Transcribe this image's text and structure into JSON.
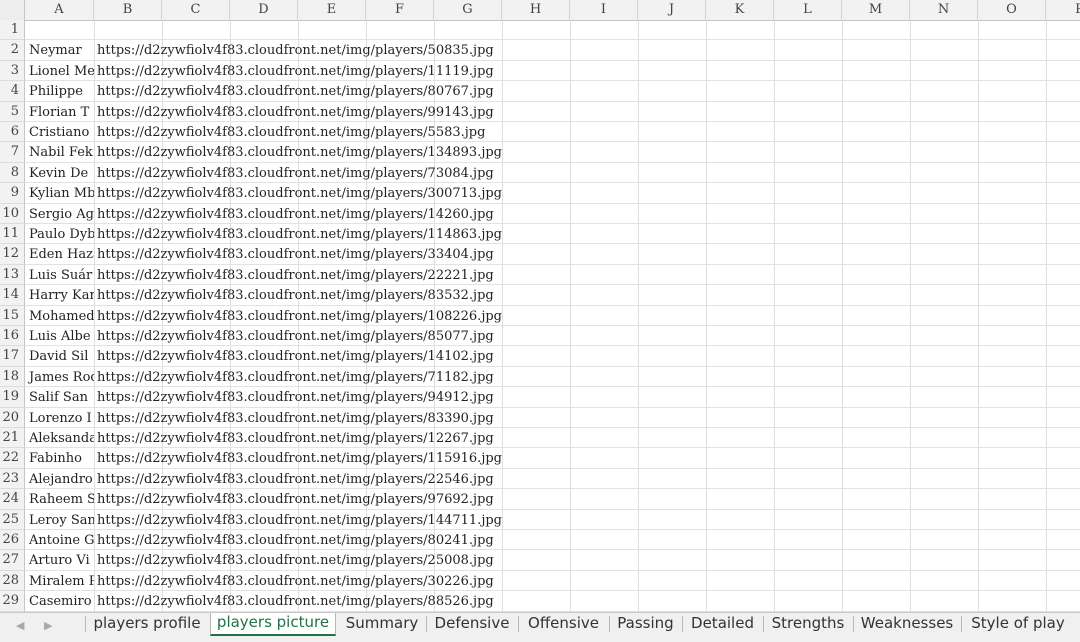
{
  "columns": [
    "A",
    "B",
    "C",
    "D",
    "E",
    "F",
    "G",
    "H",
    "I",
    "J",
    "K",
    "L",
    "M",
    "N",
    "O",
    "P"
  ],
  "rows": [
    {
      "num": "1",
      "a": "",
      "b": ""
    },
    {
      "num": "2",
      "a": "Neymar",
      "b": "https://d2zywfiolv4f83.cloudfront.net/img/players/50835.jpg"
    },
    {
      "num": "3",
      "a": "Lionel Me",
      "b": "https://d2zywfiolv4f83.cloudfront.net/img/players/11119.jpg"
    },
    {
      "num": "4",
      "a": "Philippe",
      "b": "https://d2zywfiolv4f83.cloudfront.net/img/players/80767.jpg"
    },
    {
      "num": "5",
      "a": "Florian T",
      "b": "https://d2zywfiolv4f83.cloudfront.net/img/players/99143.jpg"
    },
    {
      "num": "6",
      "a": "Cristiano",
      "b": "https://d2zywfiolv4f83.cloudfront.net/img/players/5583.jpg"
    },
    {
      "num": "7",
      "a": "Nabil Fek",
      "b": "https://d2zywfiolv4f83.cloudfront.net/img/players/134893.jpg"
    },
    {
      "num": "8",
      "a": "Kevin De",
      "b": "https://d2zywfiolv4f83.cloudfront.net/img/players/73084.jpg"
    },
    {
      "num": "9",
      "a": "Kylian Mb",
      "b": "https://d2zywfiolv4f83.cloudfront.net/img/players/300713.jpg"
    },
    {
      "num": "10",
      "a": "Sergio Ag",
      "b": "https://d2zywfiolv4f83.cloudfront.net/img/players/14260.jpg"
    },
    {
      "num": "11",
      "a": "Paulo Dyb",
      "b": "https://d2zywfiolv4f83.cloudfront.net/img/players/114863.jpg"
    },
    {
      "num": "12",
      "a": "Eden Haza",
      "b": "https://d2zywfiolv4f83.cloudfront.net/img/players/33404.jpg"
    },
    {
      "num": "13",
      "a": "Luis Suár",
      "b": "https://d2zywfiolv4f83.cloudfront.net/img/players/22221.jpg"
    },
    {
      "num": "14",
      "a": "Harry Kan",
      "b": "https://d2zywfiolv4f83.cloudfront.net/img/players/83532.jpg"
    },
    {
      "num": "15",
      "a": "Mohamed S",
      "b": "https://d2zywfiolv4f83.cloudfront.net/img/players/108226.jpg"
    },
    {
      "num": "16",
      "a": "Luis Albe",
      "b": "https://d2zywfiolv4f83.cloudfront.net/img/players/85077.jpg"
    },
    {
      "num": "17",
      "a": "David Sil",
      "b": "https://d2zywfiolv4f83.cloudfront.net/img/players/14102.jpg"
    },
    {
      "num": "18",
      "a": "James Rod",
      "b": "https://d2zywfiolv4f83.cloudfront.net/img/players/71182.jpg"
    },
    {
      "num": "19",
      "a": "Salif San",
      "b": "https://d2zywfiolv4f83.cloudfront.net/img/players/94912.jpg"
    },
    {
      "num": "20",
      "a": "Lorenzo I",
      "b": "https://d2zywfiolv4f83.cloudfront.net/img/players/83390.jpg"
    },
    {
      "num": "21",
      "a": "Aleksanda",
      "b": "https://d2zywfiolv4f83.cloudfront.net/img/players/12267.jpg"
    },
    {
      "num": "22",
      "a": "Fabinho",
      "b": "https://d2zywfiolv4f83.cloudfront.net/img/players/115916.jpg"
    },
    {
      "num": "23",
      "a": "Alejandro",
      "b": "https://d2zywfiolv4f83.cloudfront.net/img/players/22546.jpg"
    },
    {
      "num": "24",
      "a": "Raheem St",
      "b": "https://d2zywfiolv4f83.cloudfront.net/img/players/97692.jpg"
    },
    {
      "num": "25",
      "a": "Leroy San",
      "b": "https://d2zywfiolv4f83.cloudfront.net/img/players/144711.jpg"
    },
    {
      "num": "26",
      "a": "Antoine G",
      "b": "https://d2zywfiolv4f83.cloudfront.net/img/players/80241.jpg"
    },
    {
      "num": "27",
      "a": "Arturo Vi",
      "b": "https://d2zywfiolv4f83.cloudfront.net/img/players/25008.jpg"
    },
    {
      "num": "28",
      "a": "Miralem P",
      "b": "https://d2zywfiolv4f83.cloudfront.net/img/players/30226.jpg"
    },
    {
      "num": "29",
      "a": "Casemiro",
      "b": "https://d2zywfiolv4f83.cloudfront.net/img/players/88526.jpg"
    }
  ],
  "tabs": [
    {
      "label": "players profile",
      "active": false
    },
    {
      "label": "players picture",
      "active": true
    },
    {
      "label": "Summary",
      "active": false
    },
    {
      "label": "Defensive",
      "active": false
    },
    {
      "label": "Offensive",
      "active": false
    },
    {
      "label": "Passing",
      "active": false
    },
    {
      "label": "Detailed",
      "active": false
    },
    {
      "label": "Strengths",
      "active": false
    },
    {
      "label": "Weaknesses",
      "active": false
    },
    {
      "label": "Style of play",
      "active": false
    }
  ],
  "nav": {
    "prev_icon": "triangle-left-icon",
    "next_icon": "triangle-right-icon"
  },
  "colors": {
    "active_tab": "#217346",
    "header_bg": "#f2f2f2"
  }
}
